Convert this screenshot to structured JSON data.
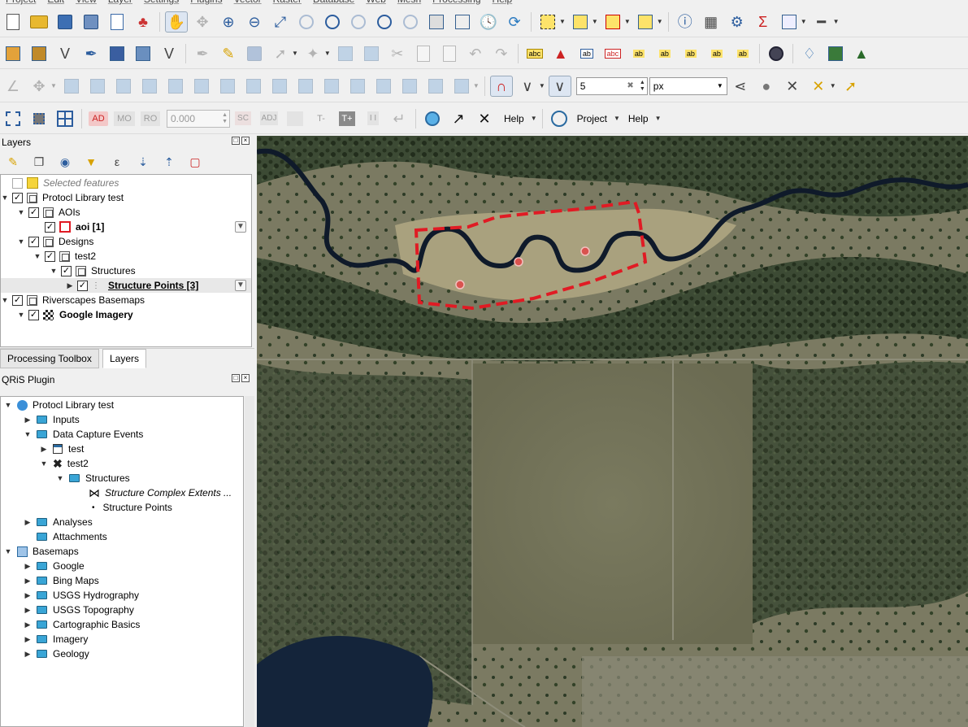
{
  "menubar": [
    "Project",
    "Edit",
    "View",
    "Layer",
    "Settings",
    "Plugins",
    "Vector",
    "Raster",
    "Database",
    "Web",
    "Mesh",
    "Processing",
    "Help"
  ],
  "toolbar4": {
    "ad_label": "AD",
    "mo_label": "MO",
    "ro_label": "RO",
    "offset_value": "0.000",
    "sc_label": "SC",
    "adj_label": "ADJ",
    "tminus_label": "T-",
    "tplus_label": "T+",
    "ii_label": "I I",
    "help1": "Help",
    "project": "Project",
    "help2": "Help"
  },
  "snapping": {
    "tolerance": "5",
    "unit": "px"
  },
  "layers_panel": {
    "title": "Layers",
    "items": [
      {
        "label": "Selected features",
        "checked": false
      },
      {
        "label": "Protocl Library test",
        "checked": true
      },
      {
        "label": "AOIs",
        "checked": true
      },
      {
        "label": "aoi [1]",
        "checked": true
      },
      {
        "label": "Designs",
        "checked": true
      },
      {
        "label": "test2",
        "checked": true
      },
      {
        "label": "Structures",
        "checked": true
      },
      {
        "label": "Structure Points [3]",
        "checked": true
      },
      {
        "label": "Riverscapes Basemaps",
        "checked": true
      },
      {
        "label": "Google Imagery",
        "checked": true
      }
    ]
  },
  "tabs": {
    "processing": "Processing Toolbox",
    "layers": "Layers"
  },
  "qris_panel": {
    "title": "QRiS Plugin",
    "items": [
      "Protocl Library test",
      "Inputs",
      "Data Capture Events",
      "test",
      "test2",
      "Structures",
      "Structure Complex Extents ...",
      "Structure Points",
      "Analyses",
      "Attachments",
      "Basemaps",
      "Google",
      "Bing Maps",
      "USGS Hydrography",
      "USGS Topography",
      "Cartographic Basics",
      "Imagery",
      "Geology"
    ]
  },
  "colors": {
    "aoi_outline": "#e01b24",
    "point_fill": "#d9534f",
    "water": "#0f1a2a"
  }
}
